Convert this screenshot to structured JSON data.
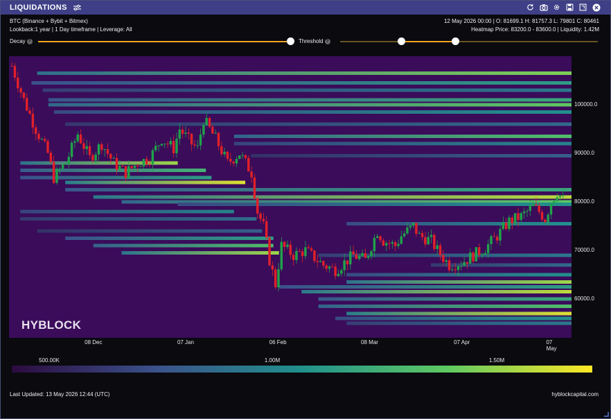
{
  "window": {
    "title": "LIQUIDATIONS",
    "icons": [
      "sliders-icon",
      "refresh-icon",
      "camera-icon",
      "gear-icon",
      "save-icon",
      "expand-icon",
      "close-icon"
    ]
  },
  "info": {
    "exchange_line": "BTC (Binance + Bybit + Bitmex)",
    "settings_line": "Lookback:1 year | 1 Day timeframe | Leverage: All",
    "ohlc_line": "12 May 2026 00:00 | O: 81699.1 H: 81757.3 L: 79801 C: 80461",
    "heatmap_line": "Heatmap Price: 83200.0 - 83600.0 | Liquidity: 1.42M"
  },
  "controls": {
    "decay_label": "Decay",
    "threshold_label": "Threshold",
    "help_glyph": "?",
    "decay_value": 1.0,
    "threshold_low": 0.24,
    "threshold_high": 0.45,
    "accent_color": "#f5a623"
  },
  "watermark": "HYBLOCK",
  "colorbar": {
    "labels": [
      "500.00K",
      "1.00M",
      "1.50M"
    ],
    "colors": [
      "#2b0b3f",
      "#3b528b",
      "#21918c",
      "#5ec962",
      "#fde725"
    ]
  },
  "footer": {
    "last_updated": "Last Updated: 13 May 2026 12:44 (UTC)",
    "site": "hyblockcapital.com"
  },
  "chart_data": {
    "type": "heatmap",
    "x_tick_labels": [
      "08 Dec",
      "07 Jan",
      "06 Feb",
      "08 Mar",
      "07 Apr",
      "07 May"
    ],
    "y_tick_labels": [
      "100000.0",
      "90000.0",
      "80000.0",
      "70000.0",
      "60000.0"
    ],
    "ylim": [
      52000,
      110000
    ],
    "up_color": "#1fa34a",
    "down_color": "#e0202a",
    "background_color": "#3a0c5a",
    "price_path": [
      [
        0,
        108000
      ],
      [
        4,
        101000
      ],
      [
        8,
        95000
      ],
      [
        12,
        90000
      ],
      [
        14,
        85000
      ],
      [
        18,
        88000
      ],
      [
        22,
        94000
      ],
      [
        26,
        89000
      ],
      [
        30,
        92000
      ],
      [
        34,
        88000
      ],
      [
        38,
        86000
      ],
      [
        42,
        88000
      ],
      [
        46,
        89000
      ],
      [
        50,
        93000
      ],
      [
        54,
        91000
      ],
      [
        56,
        95000
      ],
      [
        60,
        92000
      ],
      [
        62,
        91000
      ],
      [
        64,
        97000
      ],
      [
        68,
        93000
      ],
      [
        72,
        88000
      ],
      [
        76,
        90000
      ],
      [
        80,
        86000
      ],
      [
        82,
        78000
      ],
      [
        84,
        75000
      ],
      [
        86,
        68000
      ],
      [
        88,
        63000
      ],
      [
        90,
        71000
      ],
      [
        94,
        69000
      ],
      [
        98,
        70000
      ],
      [
        102,
        68000
      ],
      [
        104,
        67000
      ],
      [
        108,
        66000
      ],
      [
        112,
        68000
      ],
      [
        114,
        69000
      ],
      [
        118,
        68000
      ],
      [
        122,
        74000
      ],
      [
        124,
        72000
      ],
      [
        128,
        71000
      ],
      [
        130,
        73000
      ],
      [
        134,
        75000
      ],
      [
        136,
        73000
      ],
      [
        140,
        72000
      ],
      [
        142,
        70000
      ],
      [
        146,
        67000
      ],
      [
        150,
        67500
      ],
      [
        154,
        69000
      ],
      [
        158,
        70500
      ],
      [
        162,
        73000
      ],
      [
        166,
        76000
      ],
      [
        170,
        77000
      ],
      [
        174,
        79000
      ],
      [
        176,
        78000
      ],
      [
        178,
        76500
      ],
      [
        180,
        80000
      ],
      [
        182,
        82000
      ],
      [
        184,
        80500
      ]
    ],
    "bands": [
      [
        106500,
        0.05,
        1.0,
        0.8
      ],
      [
        104500,
        0.04,
        1.0,
        0.55
      ],
      [
        103000,
        0.06,
        1.0,
        0.4
      ],
      [
        101000,
        0.07,
        1.0,
        0.6
      ],
      [
        100000,
        0.07,
        1.0,
        0.75
      ],
      [
        98500,
        0.08,
        1.0,
        0.5
      ],
      [
        96000,
        0.1,
        1.0,
        0.35
      ],
      [
        93500,
        0.4,
        1.0,
        0.7
      ],
      [
        92000,
        0.4,
        1.0,
        0.45
      ],
      [
        89500,
        0.43,
        1.0,
        0.3
      ],
      [
        88000,
        0.02,
        0.3,
        0.85
      ],
      [
        86500,
        0.02,
        0.35,
        0.65
      ],
      [
        85000,
        0.02,
        0.36,
        0.55
      ],
      [
        84000,
        0.1,
        0.42,
        0.95
      ],
      [
        82500,
        0.1,
        1.0,
        0.6
      ],
      [
        81000,
        0.15,
        1.0,
        0.9
      ],
      [
        80000,
        0.2,
        1.0,
        0.75
      ],
      [
        79500,
        0.3,
        1.0,
        0.5
      ],
      [
        78000,
        0.02,
        0.4,
        0.45
      ],
      [
        76500,
        0.02,
        0.44,
        0.35
      ],
      [
        75500,
        0.6,
        1.0,
        0.5
      ],
      [
        74000,
        0.05,
        0.45,
        0.3
      ],
      [
        72500,
        0.1,
        0.47,
        0.55
      ],
      [
        71000,
        0.15,
        0.47,
        0.7
      ],
      [
        69500,
        0.2,
        0.48,
        0.85
      ],
      [
        69000,
        0.55,
        1.0,
        0.4
      ],
      [
        67000,
        0.75,
        1.0,
        0.35
      ],
      [
        65000,
        0.6,
        1.0,
        0.5
      ],
      [
        63500,
        0.6,
        1.0,
        0.85
      ],
      [
        62500,
        0.48,
        1.0,
        0.55
      ],
      [
        61500,
        0.52,
        1.0,
        0.9
      ],
      [
        60000,
        0.55,
        1.0,
        0.6
      ],
      [
        58500,
        0.55,
        1.0,
        0.7
      ],
      [
        57000,
        0.6,
        1.0,
        0.95
      ],
      [
        56000,
        0.58,
        1.0,
        0.5
      ],
      [
        55000,
        0.6,
        1.0,
        0.4
      ]
    ]
  }
}
